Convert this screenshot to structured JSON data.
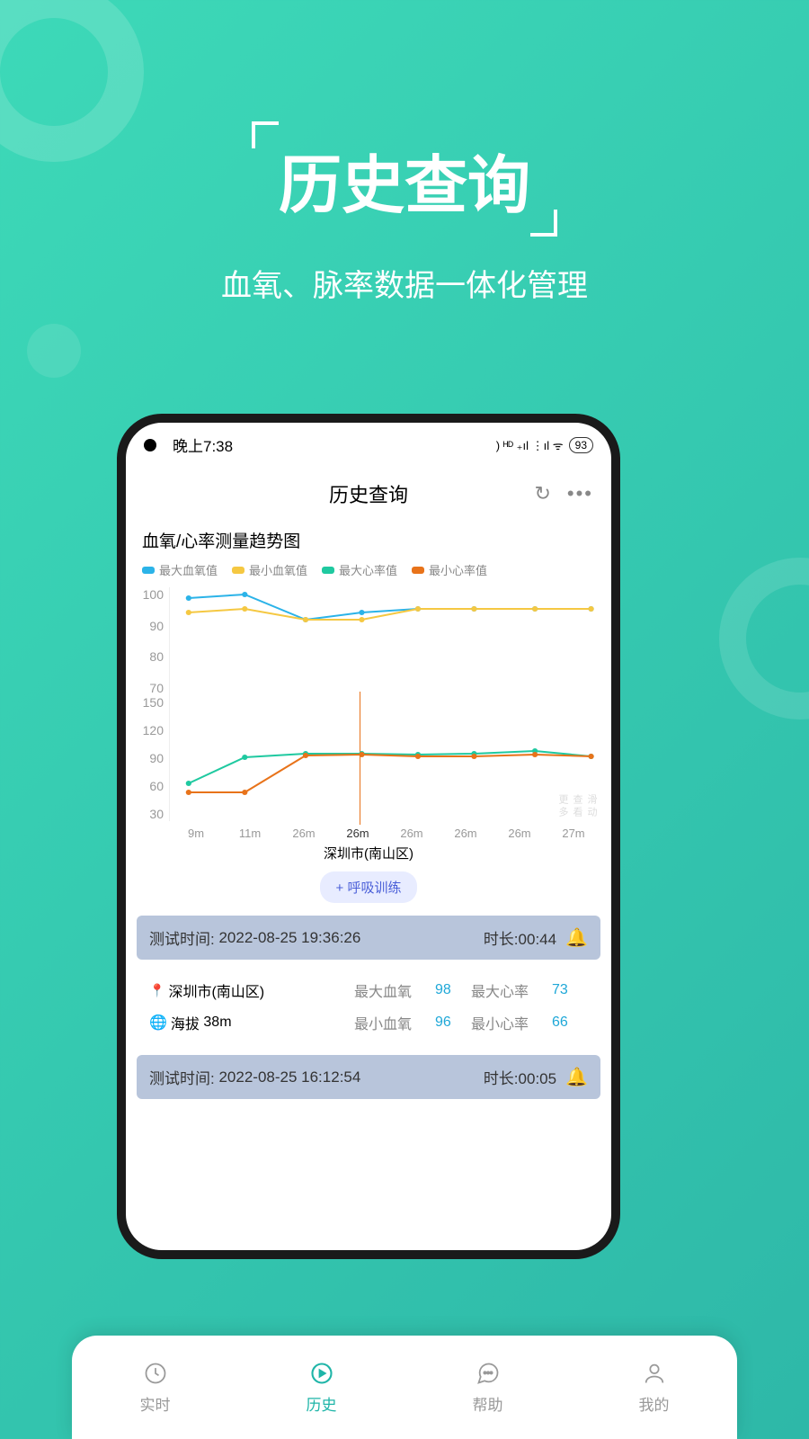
{
  "hero": {
    "title": "历史查询",
    "subtitle": "血氧、脉率数据一体化管理"
  },
  "status_bar": {
    "time": "晚上7:38",
    "battery": "93"
  },
  "header": {
    "title": "历史查询"
  },
  "chart": {
    "title": "血氧/心率测量趋势图",
    "legend": [
      "最大血氧值",
      "最小血氧值",
      "最大心率值",
      "最小心率值"
    ],
    "location": "深圳市(南山区)",
    "vertical_hint": "滑动查看更多"
  },
  "chart_data": [
    {
      "type": "line",
      "title": "血氧",
      "ylabel": "",
      "xlabel": "",
      "ylim": [
        70,
        100
      ],
      "categories": [
        "9m",
        "11m",
        "26m",
        "26m",
        "26m",
        "26m",
        "26m",
        "27m"
      ],
      "series": [
        {
          "name": "最大血氧值",
          "color": "#2bb3e8",
          "values": [
            97,
            98,
            91,
            93,
            94,
            94,
            94,
            94
          ]
        },
        {
          "name": "最小血氧值",
          "color": "#f5c842",
          "values": [
            93,
            94,
            91,
            91,
            94,
            94,
            94,
            94
          ]
        }
      ]
    },
    {
      "type": "line",
      "title": "心率",
      "ylabel": "",
      "xlabel": "",
      "ylim": [
        30,
        150
      ],
      "categories": [
        "9m",
        "11m",
        "26m",
        "26m",
        "26m",
        "26m",
        "26m",
        "27m"
      ],
      "series": [
        {
          "name": "最大心率值",
          "color": "#1fc9a0",
          "values": [
            66,
            91,
            94,
            94,
            93,
            94,
            97,
            92
          ]
        },
        {
          "name": "最小心率值",
          "color": "#e8731a",
          "values": [
            57,
            57,
            92,
            93,
            92,
            92,
            93,
            92
          ]
        }
      ]
    }
  ],
  "breath_btn": "+ 呼吸训练",
  "history": [
    {
      "time_label": "测试时间:",
      "time": "2022-08-25 19:36:26",
      "duration_label": "时长:",
      "duration": "00:44",
      "location": "深圳市(南山区)",
      "alt_label": "海拔",
      "alt": "38m",
      "max_o2_label": "最大血氧",
      "max_o2": "98",
      "max_hr_label": "最大心率",
      "max_hr": "73",
      "min_o2_label": "最小血氧",
      "min_o2": "96",
      "min_hr_label": "最小心率",
      "min_hr": "66"
    },
    {
      "time_label": "测试时间:",
      "time": "2022-08-25 16:12:54",
      "duration_label": "时长:",
      "duration": "00:05"
    }
  ],
  "tabs": [
    {
      "label": "实时"
    },
    {
      "label": "历史"
    },
    {
      "label": "帮助"
    },
    {
      "label": "我的"
    }
  ]
}
